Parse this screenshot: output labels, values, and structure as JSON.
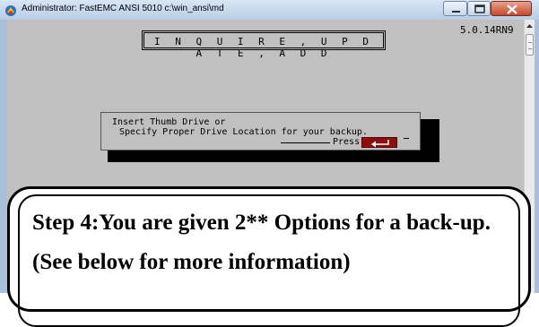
{
  "window": {
    "title": "Administrator: FastEMC ANSI 5010 c:\\win_ansi\\md",
    "icon": "fastemc-app-icon",
    "buttons": [
      "minimize-icon",
      "maximize-icon",
      "close-icon"
    ]
  },
  "console": {
    "menu_banner": "I N Q U I R E ,   U P D A T E ,   A D D",
    "version": "5.0.14RN9"
  },
  "dialog": {
    "line1": "Insert Thumb Drive or",
    "line2": "Specify Proper Drive Location for your backup.",
    "press_label": "Press",
    "key_icon": "enter-key-icon"
  },
  "callout": {
    "text": "Step 4:You are given 2** Options for a back-up. (See below for more information)"
  },
  "colors": {
    "console_bg": "#c0c0c0",
    "enter_key": "#8a0f0f",
    "close_button": "#c4472b"
  }
}
